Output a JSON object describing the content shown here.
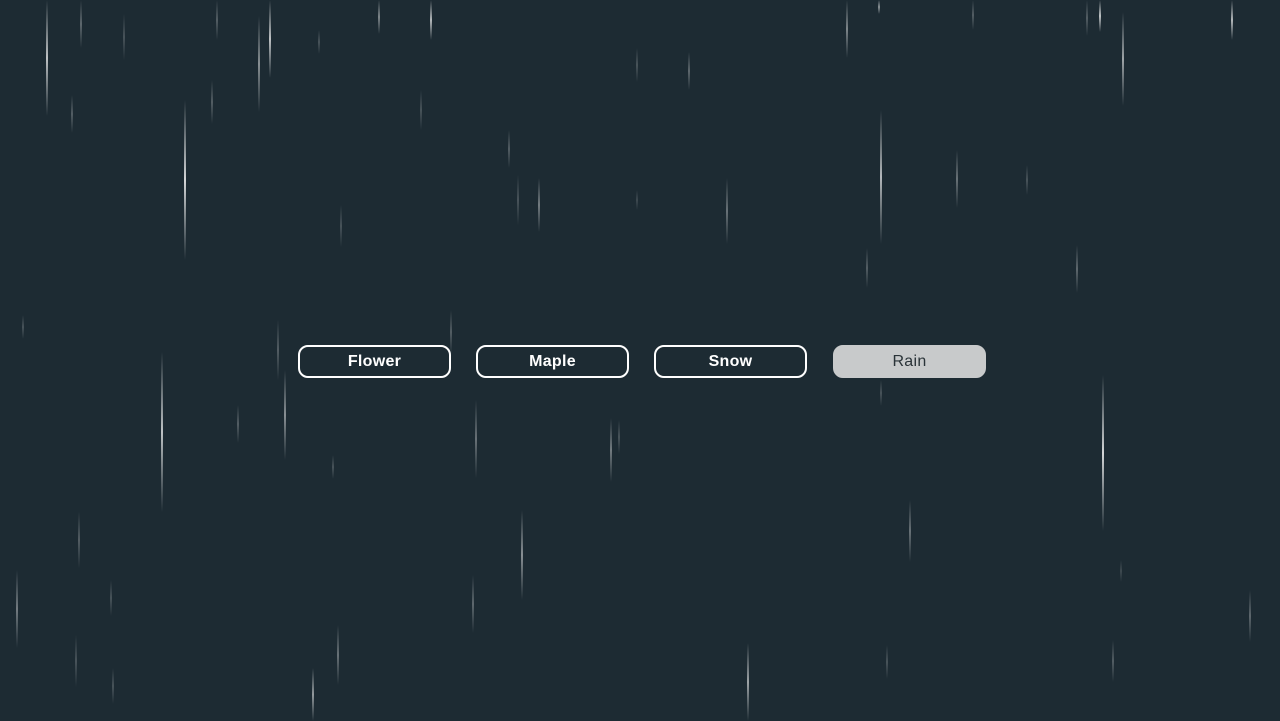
{
  "theme": {
    "background": "#1d2b33",
    "button_border": "#ffffff",
    "button_text": "#ffffff",
    "active_background": "#c8cacb",
    "active_text": "#2a3338"
  },
  "effects": {
    "buttons": [
      {
        "label": "Flower",
        "active": false
      },
      {
        "label": "Maple",
        "active": false
      },
      {
        "label": "Snow",
        "active": false
      },
      {
        "label": "Rain",
        "active": true
      }
    ]
  }
}
